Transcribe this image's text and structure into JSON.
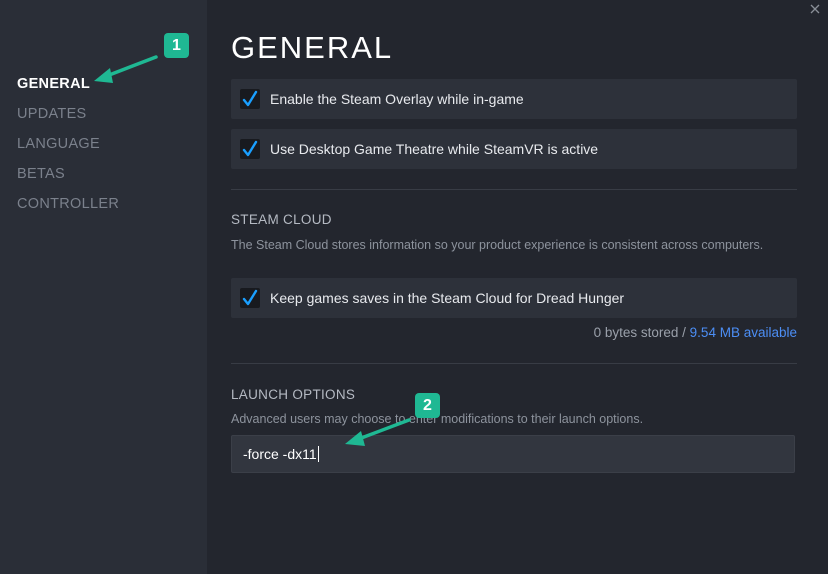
{
  "sidebar": {
    "items": [
      {
        "label": "GENERAL",
        "active": true
      },
      {
        "label": "UPDATES",
        "active": false
      },
      {
        "label": "LANGUAGE",
        "active": false
      },
      {
        "label": "BETAS",
        "active": false
      },
      {
        "label": "CONTROLLER",
        "active": false
      }
    ]
  },
  "main": {
    "title": "GENERAL",
    "options": [
      {
        "label": "Enable the Steam Overlay while in-game",
        "checked": true
      },
      {
        "label": "Use Desktop Game Theatre while SteamVR is active",
        "checked": true
      }
    ],
    "steam_cloud": {
      "title": "STEAM CLOUD",
      "description": "The Steam Cloud stores information so your product experience is consistent across computers.",
      "option": {
        "label": "Keep games saves in the Steam Cloud for Dread Hunger",
        "checked": true
      },
      "stored": "0 bytes stored",
      "separator": " / ",
      "available": "9.54 MB available"
    },
    "launch_options": {
      "title": "LAUNCH OPTIONS",
      "description": "Advanced users may choose to enter modifications to their launch options.",
      "value": "-force -dx11"
    }
  },
  "annotations": {
    "badge1": "1",
    "badge2": "2"
  },
  "colors": {
    "accent_check": "#1a9fff",
    "link": "#4c8ef5",
    "annotation": "#1fb893"
  },
  "icons": {
    "close": "close-icon",
    "check": "check-icon"
  }
}
